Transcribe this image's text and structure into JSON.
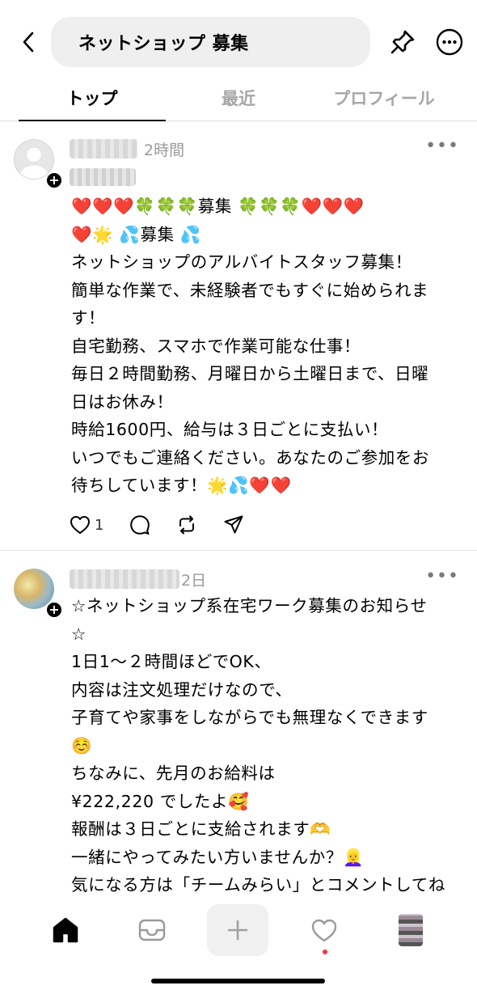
{
  "header": {
    "search_query": "ネットショップ 募集"
  },
  "tabs": [
    {
      "label": "トップ",
      "active": true
    },
    {
      "label": "最近",
      "active": false
    },
    {
      "label": "プロフィール",
      "active": false
    }
  ],
  "posts": [
    {
      "time": "2時間",
      "body": "❤️❤️❤️🍀🍀🍀募集 🍀🍀🍀❤️❤️❤️\n❤️🌟 💦募集 💦\nネットショップのアルバイトスタッフ募集！\n簡単な作業で、未経験者でもすぐに始められま\nす！\n自宅勤務、スマホで作業可能な仕事！\n毎日２時間勤務、月曜日から土曜日まで、日曜\n日はお休み！\n時給1600円、給与は３日ごとに支払い！\nいつでもご連絡ください。あなたのご参加をお\n待ちしています！🌟💦❤️❤️",
      "like_count": "1"
    },
    {
      "time": "2日",
      "body": "☆ネットショップ系在宅ワーク募集のお知らせ\n☆\n1日1〜２時間ほどでOK、\n内容は注文処理だけなので、\n子育てや家事をしながらでも無理なくできます\n☺️\nちなみに、先月のお給料は\n¥222,220 でしたよ🥰\n報酬は３日ごとに支給されます🫶\n一緒にやってみたい方いませんか？👱‍♀️\n気になる方は「チームみらい」とコメントしてね"
    }
  ],
  "more_glyph": "•••",
  "plus_glyph": "+",
  "colors": {
    "text": "#000000",
    "muted": "#9a9a9a",
    "inactive_tab": "#a6a6a6",
    "notification_dot": "#ff3040"
  }
}
